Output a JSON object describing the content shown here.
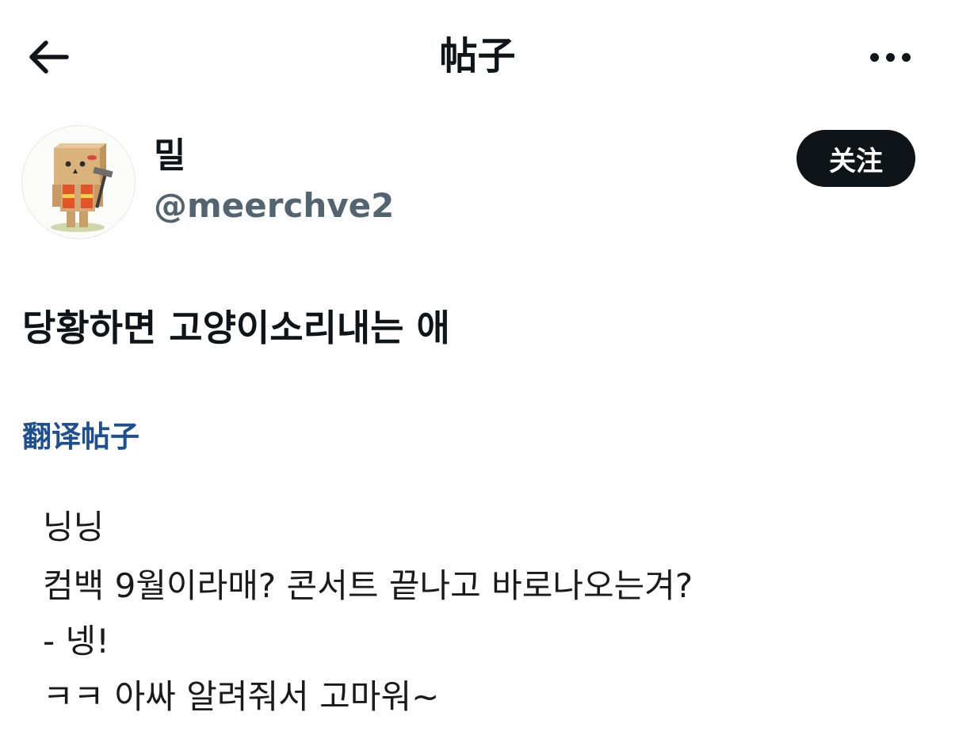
{
  "header": {
    "title": "帖子",
    "back_icon": "arrow-left-icon",
    "more_icon": "more-horizontal-icon"
  },
  "author": {
    "display_name": "밀",
    "handle": "@meerchve2",
    "avatar_icon": "danbo-cardboard-figure-avatar",
    "follow_label": "关注"
  },
  "post": {
    "text": "당황하면 고양이소리내는 애",
    "translate_label": "翻译帖子"
  },
  "media": {
    "lines": [
      "닝닝",
      "컴백 9월이라매? 콘서트 끝나고 바로나오는겨?",
      "- 넹!",
      "ㅋㅋ 아싸 알려줘서 고마워~"
    ]
  },
  "colors": {
    "text": "#0f1419",
    "secondary": "#536471",
    "link": "#1d4f91",
    "button_bg": "#0f1419",
    "button_text": "#ffffff"
  }
}
